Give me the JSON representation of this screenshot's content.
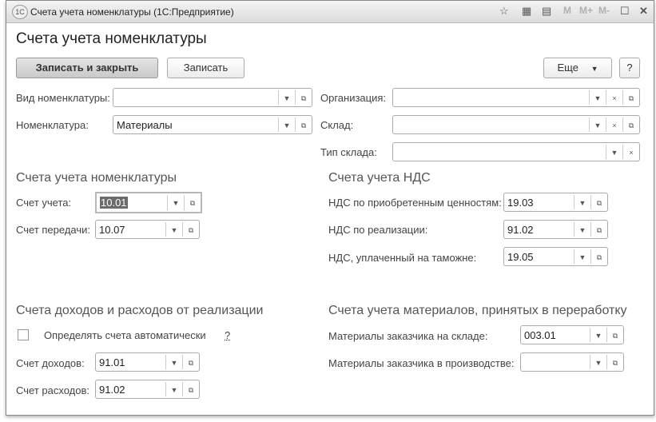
{
  "window": {
    "title": "Счета учета номенклатуры  (1С:Предприятие)",
    "logo": "1С",
    "toolbar": {
      "m": "M",
      "mplus": "M+",
      "mminus": "M-"
    }
  },
  "page": {
    "title": "Счета учета номенклатуры"
  },
  "commands": {
    "save_close": "Записать и закрыть",
    "save": "Записать",
    "more": "Еще",
    "help": "?"
  },
  "header_fields": {
    "kind": {
      "label": "Вид номенклатуры:",
      "value": ""
    },
    "item": {
      "label": "Номенклатура:",
      "value": "Материалы"
    },
    "org": {
      "label": "Организация:",
      "value": ""
    },
    "warehouse": {
      "label": "Склад:",
      "value": ""
    },
    "warehouse_type": {
      "label": "Тип склада:",
      "value": ""
    }
  },
  "sections": {
    "item_accounts": {
      "title": "Счета учета номенклатуры",
      "account": {
        "label": "Счет учета:",
        "value": "10.01"
      },
      "transfer": {
        "label": "Счет передачи:",
        "value": "10.07"
      }
    },
    "vat": {
      "title": "Счета учета НДС",
      "purchased": {
        "label": "НДС по приобретенным ценностям:",
        "value": "19.03"
      },
      "sales": {
        "label": "НДС по реализации:",
        "value": "91.02"
      },
      "customs": {
        "label": "НДС, уплаченный на таможне:",
        "value": "19.05"
      }
    },
    "income": {
      "title": "Счета доходов и расходов от реализации",
      "auto": {
        "label": "Определять счета автоматически",
        "checked": false,
        "help": "?"
      },
      "income": {
        "label": "Счет доходов:",
        "value": "91.01"
      },
      "expense": {
        "label": "Счет расходов:",
        "value": "91.02"
      }
    },
    "processing": {
      "title": "Счета учета материалов, принятых в переработку",
      "in_stock": {
        "label": "Материалы заказчика на складе:",
        "value": "003.01"
      },
      "in_production": {
        "label": "Материалы заказчика в производстве:",
        "value": ""
      }
    }
  }
}
